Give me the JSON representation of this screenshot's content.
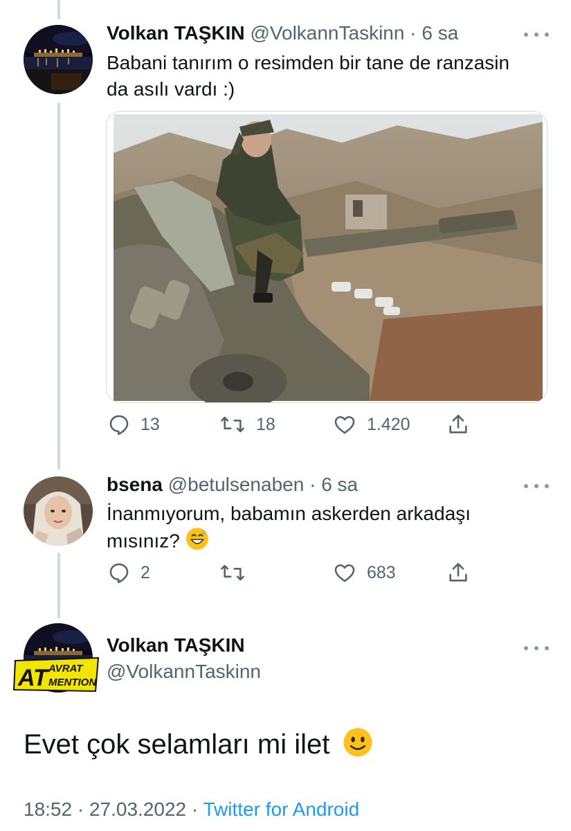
{
  "tweet1": {
    "display_name": "Volkan TAŞKIN",
    "handle": "@VolkannTaskinn",
    "separator": "·",
    "time": "6 sa",
    "text_line1": "Babani tanırım o resimden bir tane de ranzasin",
    "text_line2": "da asılı vardı :)",
    "replies": "13",
    "retweets": "18",
    "likes": "1.420"
  },
  "tweet2": {
    "display_name": "bsena",
    "handle": "@betulsenaben",
    "separator": "·",
    "time": "6 sa",
    "text_line1": "İnanmıyorum, babamın askerden arkadaşı",
    "text_line2": "mısınız?",
    "replies": "2",
    "likes": "683"
  },
  "main_tweet": {
    "display_name": "Volkan TAŞKIN",
    "handle": "@VolkannTaskinn",
    "text": "Evet çok selamları mi ilet",
    "time": "18:52",
    "separator": "·",
    "date": "27.03.2022",
    "source": "Twitter for Android"
  },
  "watermark": {
    "word1": "AVRAT",
    "word2": "AT",
    "word3": "MENTION"
  },
  "colors": {
    "text_primary": "#0f1419",
    "text_secondary": "#536471",
    "link": "#1d9bf0",
    "thread_line": "#cfd9de"
  }
}
